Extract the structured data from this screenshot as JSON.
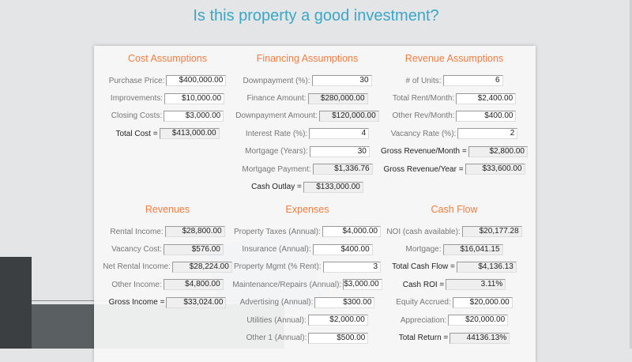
{
  "title": "Is this property a good investment?",
  "sections": [
    {
      "heading": "Cost Assumptions",
      "rows": [
        {
          "label": "Purchase Price:",
          "value": "$400,000.00",
          "calc": false,
          "total": false
        },
        {
          "label": "Improvements:",
          "value": "$10,000.00",
          "calc": false,
          "total": false
        },
        {
          "label": "Closing Costs:",
          "value": "$3,000.00",
          "calc": false,
          "total": false
        },
        {
          "label": "Total Cost =",
          "value": "$413,000.00",
          "calc": true,
          "total": true
        }
      ]
    },
    {
      "heading": "Financing Assumptions",
      "rows": [
        {
          "label": "Downpayment (%):",
          "value": "30",
          "calc": false,
          "total": false
        },
        {
          "label": "Finance Amount:",
          "value": "$280,000.00",
          "calc": true,
          "total": false
        },
        {
          "label": "Downpayment Amount:",
          "value": "$120,000.00",
          "calc": true,
          "total": false
        },
        {
          "label": "Interest Rate (%):",
          "value": "4",
          "calc": false,
          "total": false
        },
        {
          "label": "Mortgage (Years):",
          "value": "30",
          "calc": false,
          "total": false
        },
        {
          "label": "Mortgage Payment:",
          "value": "$1,336.76",
          "calc": true,
          "total": false
        },
        {
          "label": "Cash Outlay =",
          "value": "$133,000.00",
          "calc": true,
          "total": true
        }
      ]
    },
    {
      "heading": "Revenue Assumptions",
      "rows": [
        {
          "label": "# of Units:",
          "value": "6",
          "calc": false,
          "total": false
        },
        {
          "label": "Total Rent/Month:",
          "value": "$2,400.00",
          "calc": false,
          "total": false
        },
        {
          "label": "Other Rev/Month:",
          "value": "$400.00",
          "calc": false,
          "total": false
        },
        {
          "label": "Vacancy Rate (%):",
          "value": "2",
          "calc": false,
          "total": false
        },
        {
          "label": "Gross Revenue/Month =",
          "value": "$2,800.00",
          "calc": true,
          "total": true
        },
        {
          "label": "Gross Revenue/Year =",
          "value": "$33,600.00",
          "calc": true,
          "total": true
        }
      ]
    },
    {
      "heading": "Revenues",
      "rows": [
        {
          "label": "Rental Income:",
          "value": "$28,800.00",
          "calc": true,
          "total": false
        },
        {
          "label": "Vacancy Cost:",
          "value": "$576.00",
          "calc": true,
          "total": false
        },
        {
          "label": "Net Rental Income:",
          "value": "$28,224.00",
          "calc": true,
          "total": false
        },
        {
          "label": "Other Income:",
          "value": "$4,800.00",
          "calc": true,
          "total": false
        },
        {
          "label": "Gross Income =",
          "value": "$33,024.00",
          "calc": true,
          "total": true
        }
      ]
    },
    {
      "heading": "Expenses",
      "rows": [
        {
          "label": "Property Taxes (Annual):",
          "value": "$4,000.00",
          "calc": false,
          "total": false
        },
        {
          "label": "Insurance (Annual):",
          "value": "$400.00",
          "calc": false,
          "total": false
        },
        {
          "label": "Property Mgmt (% Rent):",
          "value": "3",
          "calc": false,
          "total": false
        },
        {
          "label": "Maintenance/Repairs (Annual):",
          "value": "$3,000.00",
          "calc": false,
          "total": false
        },
        {
          "label": "Advertising (Annual):",
          "value": "$300.00",
          "calc": false,
          "total": false
        },
        {
          "label": "Utilities (Annual):",
          "value": "$2,000.00",
          "calc": false,
          "total": false
        },
        {
          "label": "Other 1 (Annual):",
          "value": "$500.00",
          "calc": false,
          "total": false
        }
      ]
    },
    {
      "heading": "Cash Flow",
      "rows": [
        {
          "label": "NOI (cash available):",
          "value": "$20,177.28",
          "calc": true,
          "total": false
        },
        {
          "label": "Mortgage:",
          "value": "$16,041.15",
          "calc": true,
          "total": false
        },
        {
          "label": "Total Cash Flow =",
          "value": "$4,136.13",
          "calc": true,
          "total": true
        },
        {
          "label": "Cash ROI =",
          "value": "3.11%",
          "calc": true,
          "total": true
        },
        {
          "label": "Equity Accrued:",
          "value": "$20,000.00",
          "calc": false,
          "total": false
        },
        {
          "label": "Appreciation:",
          "value": "$20,000.00",
          "calc": false,
          "total": false
        },
        {
          "label": "Total Return =",
          "value": "44136.13%",
          "calc": true,
          "total": true
        }
      ]
    }
  ]
}
